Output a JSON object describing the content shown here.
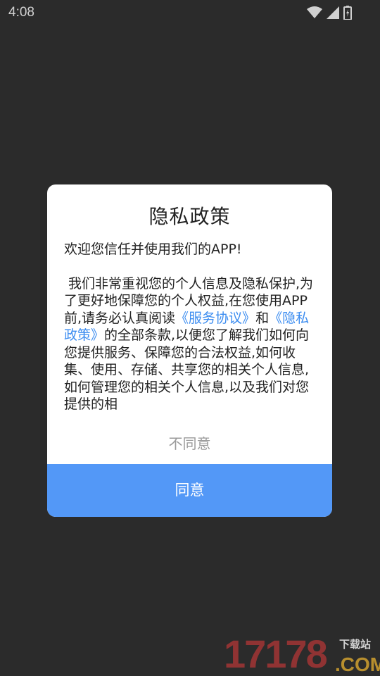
{
  "status_bar": {
    "time": "4:08",
    "icons": [
      "wifi-icon",
      "cellular-signal-icon",
      "battery-icon"
    ]
  },
  "dialog": {
    "title": "隐私政策",
    "welcome": "欢迎您信任并使用我们的APP!",
    "body": {
      "text_1": "我们非常重视您的个人信息及隐私保护,为了更好地保障您的个人权益,在您使用APP前,请务必认真阅读",
      "link_service": "《服务协议》",
      "text_and": "和",
      "link_privacy": "《隐私政策》",
      "text_2": "的全部条款,以便您了解我们如何向您提供服务、保障您的合法权益,如何收集、使用、存储、共享您的相关个人信息,如何管理您的相关个人信息,以及我们对您提供的相"
    },
    "disagree_label": "不同意",
    "agree_label": "同意"
  },
  "watermark": {
    "digits": "17178",
    "tag": "下载站",
    "domain": ".COM"
  },
  "colors": {
    "background": "#2b2b2b",
    "link": "#3b8cf0",
    "agree_button": "#5398f7",
    "disagree_text": "#9a9a9a"
  }
}
